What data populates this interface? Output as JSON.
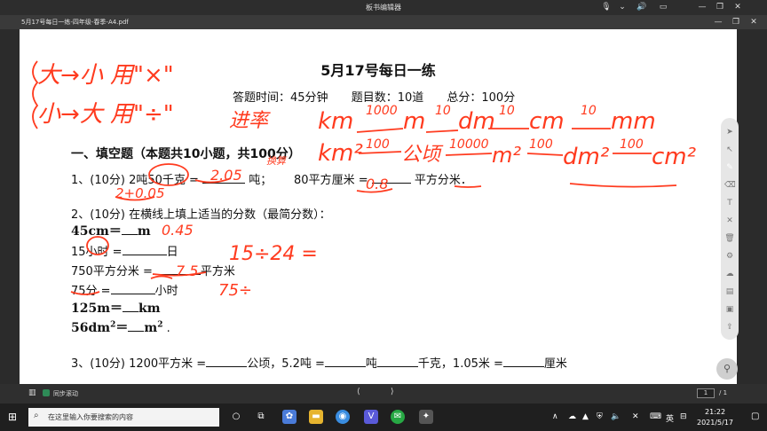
{
  "window": {
    "title": "板书编辑器",
    "doc_tab": "5月17号每日一练-四年级-春季-A4.pdf"
  },
  "document": {
    "heading": "5月17号每日一练",
    "meta": {
      "time": "答题时间：45分钟",
      "count": "题目数：10道",
      "score": "总分：100分"
    },
    "section1": "一、填空题（本题共10小题，共100分）",
    "q1": {
      "prefix": "1、(10分) 2吨50千克 =",
      "mid": "吨；",
      "mid2": "80平方厘米 =",
      "suffix": "平方分米．"
    },
    "q2_intro": "2、(10分) 在横线上填上适当的分数（最简分数）：",
    "q2_a": {
      "left": "45cm＝",
      "unit": "m"
    },
    "q2_b": {
      "left": "15小时 =",
      "unit": "日"
    },
    "q2_c": {
      "left": "750平方分米 =",
      "unit": "平方米"
    },
    "q2_d": {
      "left": "75分 =",
      "unit": "小时"
    },
    "q2_e": {
      "left": "125m＝",
      "unit": "km"
    },
    "q2_f": {
      "left": "56dm",
      "exp": "2",
      "mid": "＝",
      "unit": "m",
      "unit_exp": "2",
      "end": "."
    },
    "q3": {
      "p1": "3、(10分) 1200平方米 =",
      "p2": "公顷，5.2吨 =",
      "p3": "吨",
      "p4": "千克，1.05米 =",
      "p5": "厘米"
    }
  },
  "ink": {
    "color": "#ff3b1f",
    "blue": "#2a63ff",
    "l1": "大→小 用\"×\"",
    "l2": "小→大 用\"÷\"",
    "l2b": "进率",
    "units1": [
      "km",
      "1000",
      "m",
      "10",
      "dm",
      "10",
      "cm",
      "10",
      "mm"
    ],
    "units2": [
      "km²",
      "100",
      "公顷",
      "10000",
      "m²",
      "100",
      "dm²",
      "100",
      "cm²"
    ],
    "ans1a": "2.05",
    "ans1b": "0.8",
    "work1": "2+0.05",
    "work1b": "换算",
    "ans2a": "0.45",
    "work2b": "15÷24 =",
    "ans2c": "7.5",
    "work2d": "75÷"
  },
  "statusbar": {
    "sync": "同步滚动",
    "page": "1",
    "total": "/ 1"
  },
  "taskbar": {
    "search_placeholder": "在这里输入你要搜索的内容",
    "time": "21:22",
    "date": "2021/5/17",
    "lang": "英"
  },
  "colors": {
    "accent": "#2e8b57"
  }
}
